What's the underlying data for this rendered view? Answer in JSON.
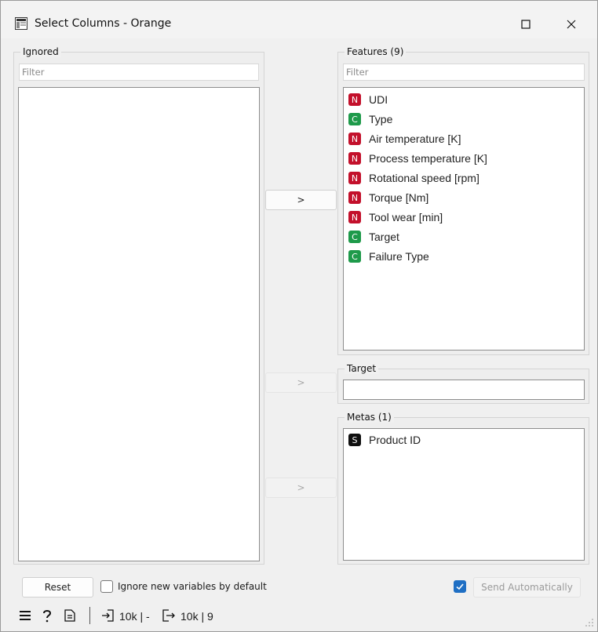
{
  "window": {
    "title": "Select Columns - Orange"
  },
  "ignored": {
    "title": "Ignored",
    "filter_placeholder": "Filter",
    "items": []
  },
  "features": {
    "title": "Features (9)",
    "filter_placeholder": "Filter",
    "items": [
      {
        "badge": "N",
        "label": "UDI"
      },
      {
        "badge": "C",
        "label": "Type"
      },
      {
        "badge": "N",
        "label": "Air temperature [K]"
      },
      {
        "badge": "N",
        "label": "Process temperature [K]"
      },
      {
        "badge": "N",
        "label": "Rotational speed [rpm]"
      },
      {
        "badge": "N",
        "label": "Torque [Nm]"
      },
      {
        "badge": "N",
        "label": "Tool wear [min]"
      },
      {
        "badge": "C",
        "label": "Target"
      },
      {
        "badge": "C",
        "label": "Failure Type"
      }
    ]
  },
  "target": {
    "title": "Target"
  },
  "metas": {
    "title": "Metas (1)",
    "items": [
      {
        "badge": "S",
        "label": "Product ID"
      }
    ]
  },
  "move_buttons": {
    "features": ">",
    "target": ">",
    "metas": ">"
  },
  "footer": {
    "reset_label": "Reset",
    "ignore_new_label": "Ignore new variables by default",
    "ignore_new_checked": false,
    "send_auto_label": "Send Automatically",
    "send_auto_checked": true
  },
  "statusbar": {
    "input_summary": "10k | -",
    "output_summary": "10k | 9"
  },
  "colors": {
    "numeric": "#c3102b",
    "categorical": "#1e9a4a",
    "string": "#101010",
    "accent": "#1f6fc4"
  }
}
